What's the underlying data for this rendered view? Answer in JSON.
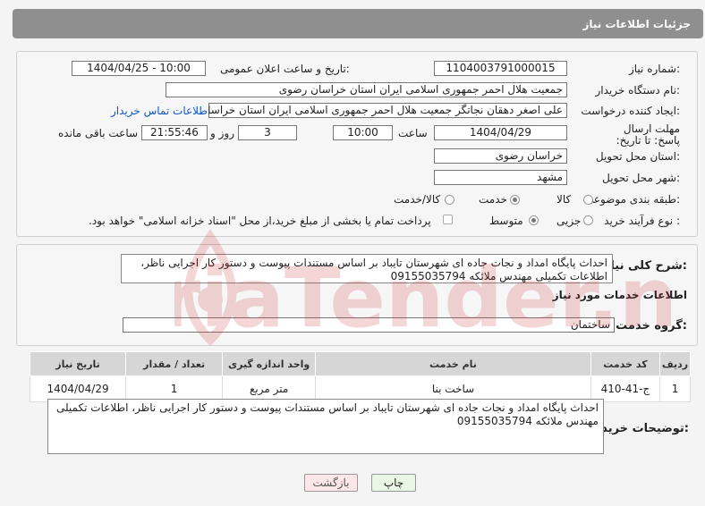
{
  "header": {
    "title": "جزئیات اطلاعات نیاز"
  },
  "form": {
    "need_number_label": "شماره نیاز:",
    "need_number": "1104003791000015",
    "announce_label": "تاریخ و ساعت اعلان عمومی:",
    "announce_value": "1404/04/25 - 10:00",
    "buyer_org_label": "نام دستگاه خریدار:",
    "buyer_org": "جمعیت هلال احمر جمهوری اسلامی ایران استان خراسان رضوی",
    "creator_label": "ایجاد کننده درخواست:",
    "creator": "علی اصغر دهقان نجاتگر جمعیت هلال احمر جمهوری اسلامی ایران استان خراسان رضوی",
    "buyer_contact_link": "اطلاعات تماس خریدار",
    "deadline_label": "مهلت ارسال پاسخ: تا تاریخ:",
    "deadline_date": "1404/04/29",
    "time_label": "ساعت",
    "deadline_time": "10:00",
    "days_value": "3",
    "days_label": "روز و",
    "remaining_time": "21:55:46",
    "remaining_label": "ساعت باقی مانده",
    "province_label": "استان محل تحویل:",
    "province": "خراسان رضوی",
    "city_label": "شهر محل تحویل:",
    "city": "مشهد",
    "category_label": "طبقه بندی موضوعی:",
    "category_options": [
      "کالا",
      "خدمت",
      "کالا/خدمت"
    ],
    "process_label": "نوع فرآیند خرید :",
    "process_options": [
      "جزیی",
      "متوسط"
    ],
    "payment_note": "پرداخت تمام یا بخشی از مبلغ خرید،از محل \"اسناد خزانه اسلامی\" خواهد بود."
  },
  "summary": {
    "label": "شرح کلی نیاز:",
    "text": "احداث پایگاه امداد و نجات جاده ای شهرستان تایباد بر اساس مستندات پیوست  و دستور کار اجرایی ناظر، اطلاعات تکمیلی مهندس ملائکه 09155035794"
  },
  "services": {
    "section_title": "اطلاعات خدمات مورد نیاز",
    "group_label": "گروه خدمت:",
    "group_value": "ساختمان",
    "columns": [
      "ردیف",
      "کد خدمت",
      "نام خدمت",
      "واحد اندازه گیری",
      "تعداد / مقدار",
      "تاریخ نیاز"
    ],
    "rows": [
      [
        "1",
        "ج-41-410",
        "ساخت بنا",
        "متر مربع",
        "1",
        "1404/04/29"
      ]
    ]
  },
  "buyer_notes": {
    "label": "توضیحات خریدار:",
    "text": "احداث پایگاه امداد و نجات جاده ای شهرستان تایباد بر اساس مستندات پیوست  و دستور کار اجرایی ناظر، اطلاعات تکمیلی مهندس ملائکه 09155035794"
  },
  "buttons": {
    "print": "چاپ",
    "back": "بازگشت"
  },
  "watermark_text": "AriaTender.neT",
  "colors": {
    "header_bg": "#8f8f8f",
    "link": "#1155cc",
    "back_button_bg": "#fde6ea",
    "print_button_bg": "#e8f6e3"
  }
}
